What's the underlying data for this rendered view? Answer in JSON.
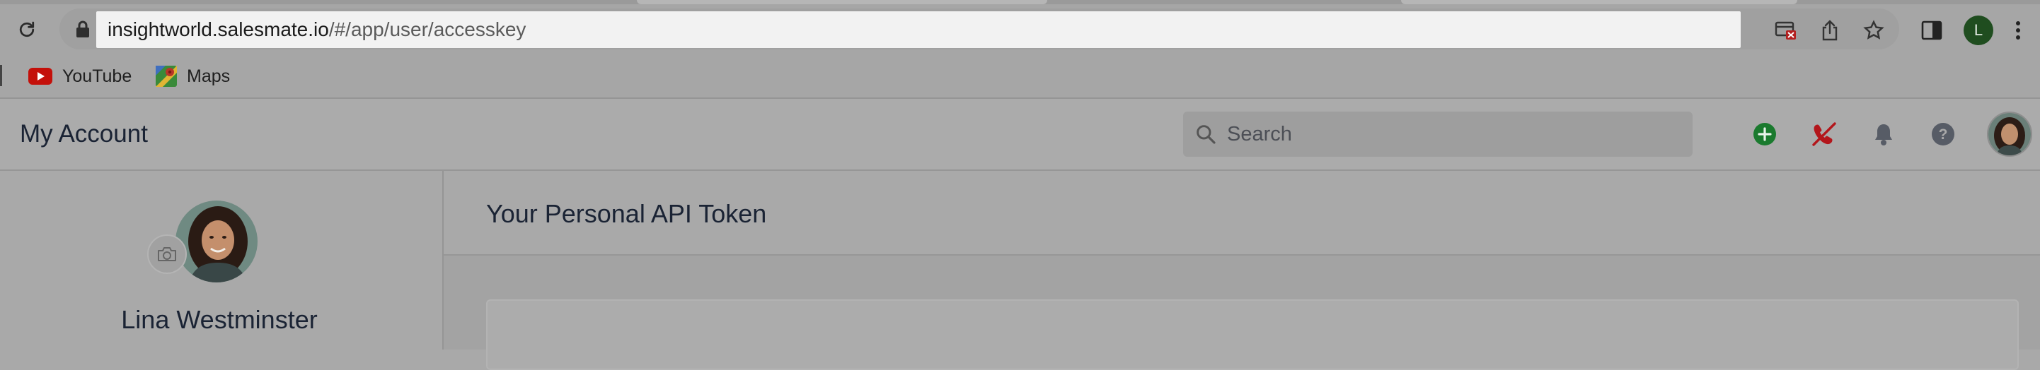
{
  "browser": {
    "url_host": "insightworld.salesmate.io",
    "url_path": "/#/app/user/accesskey",
    "profile_initial": "L",
    "bookmarks": [
      {
        "label": "YouTube",
        "icon": "youtube-icon"
      },
      {
        "label": "Maps",
        "icon": "maps-icon"
      }
    ]
  },
  "header": {
    "title": "My Account",
    "search_placeholder": "Search",
    "icons": [
      "add-icon",
      "phone-off-icon",
      "bell-icon",
      "help-icon",
      "avatar"
    ]
  },
  "sidebar": {
    "user_name": "Lina Westminster"
  },
  "main": {
    "section_title": "Your Personal API Token"
  },
  "colors": {
    "add_green": "#1a7a2e",
    "phone_red": "#b3161b",
    "profile_green": "#1f4d1f",
    "youtube_red": "#c4100a"
  }
}
